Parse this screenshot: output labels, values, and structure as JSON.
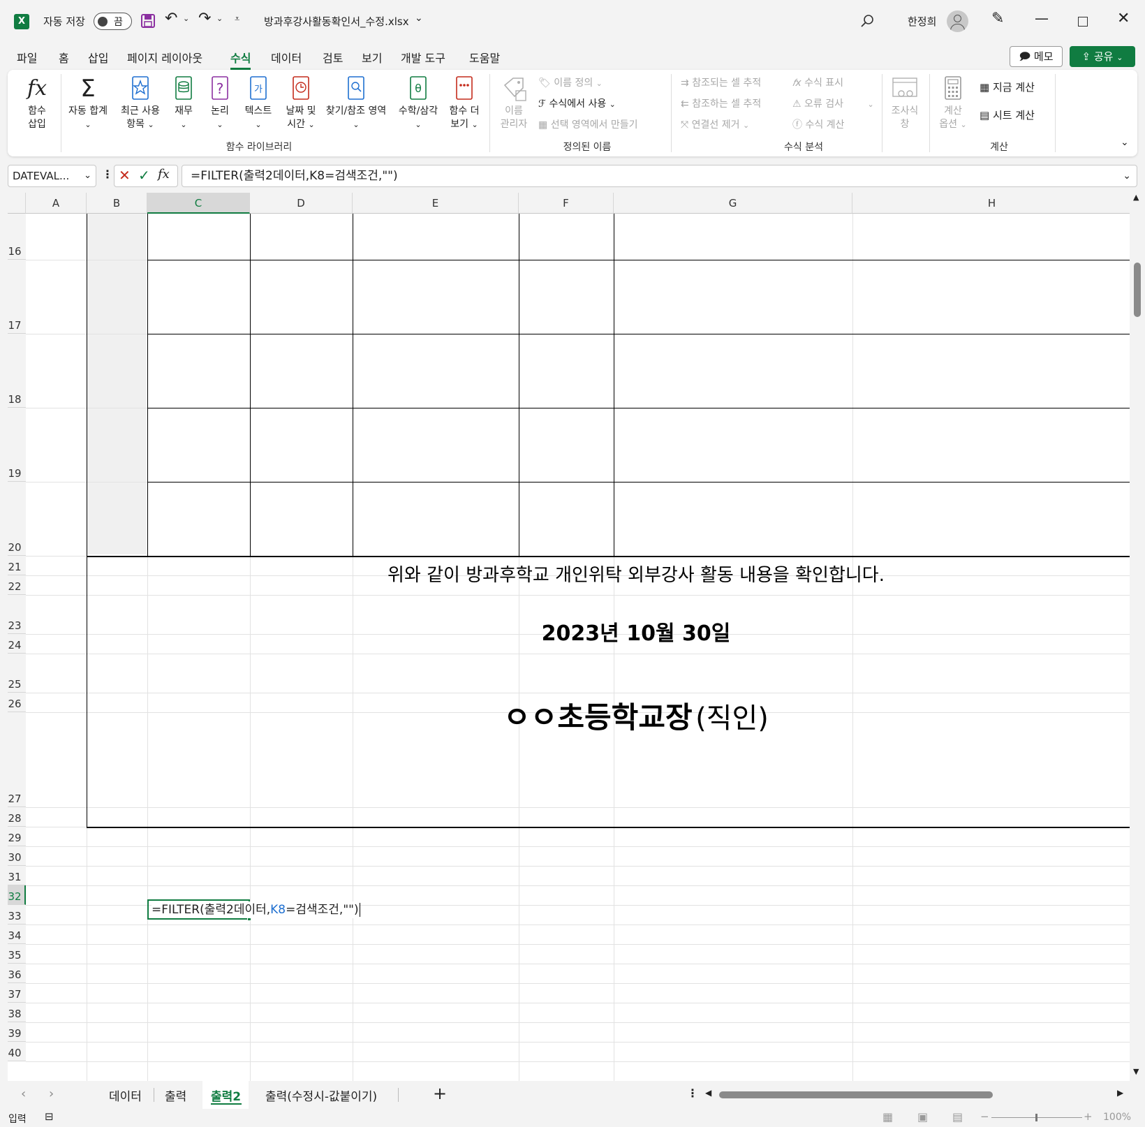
{
  "titlebar": {
    "autosave_label": "자동 저장",
    "autosave_state": "끔",
    "filename": "방과후강사활동확인서_수정.xlsx",
    "user_name": "한정희"
  },
  "menu": {
    "tabs": [
      "파일",
      "홈",
      "삽입",
      "페이지 레이아웃",
      "수식",
      "데이터",
      "검토",
      "보기",
      "개발 도구",
      "도움말"
    ],
    "active_tab": "수식",
    "memo_label": "메모",
    "share_label": "공유"
  },
  "ribbon": {
    "insert_function": [
      "함수",
      "삽입"
    ],
    "autosum": "자동 합계",
    "recent": [
      "최근 사용",
      "항목"
    ],
    "financial": "재무",
    "logical": "논리",
    "text": "텍스트",
    "datetime": [
      "날짜 및",
      "시간"
    ],
    "lookup": "찾기/참조 영역",
    "math": "수학/삼각",
    "more": [
      "함수 더",
      "보기"
    ],
    "group_library": "함수 라이브러리",
    "name_manager": [
      "이름",
      "관리자"
    ],
    "define_name": "이름 정의",
    "use_in_formula": "수식에서 사용",
    "create_from_selection": "선택 영역에서 만들기",
    "group_names": "정의된 이름",
    "trace_precedents": "참조되는 셀 추적",
    "trace_dependents": "참조하는 셀 추적",
    "remove_arrows": "연결선 제거",
    "show_formulas": "수식 표시",
    "error_checking": "오류 검사",
    "evaluate_formula": "수식 계산",
    "watch_window": [
      "조사식",
      "창"
    ],
    "group_audit": "수식 분석",
    "calc_options": [
      "계산",
      "옵션"
    ],
    "calc_now": "지금 계산",
    "calc_sheet": "시트 계산",
    "group_calc": "계산"
  },
  "formula_bar": {
    "name_box": "DATEVAL...",
    "formula": "=FILTER(출력2데이터,K8=검색조건,\"\")"
  },
  "columns": [
    "A",
    "B",
    "C",
    "D",
    "E",
    "F",
    "G",
    "H"
  ],
  "selected_column": "C",
  "rows": [
    "16",
    "17",
    "18",
    "19",
    "20",
    "21",
    "22",
    "23",
    "24",
    "25",
    "26",
    "27",
    "28",
    "29",
    "30",
    "31",
    "32",
    "33",
    "34",
    "35",
    "36",
    "37",
    "38",
    "39",
    "40"
  ],
  "selected_row": "32",
  "cells": {
    "confirm_text": "위와 같이 방과후학교 개인위탁 외부강사 활동 내용을 확인합니다.",
    "date_text": "2023년 10월 30일",
    "principal_text": "ㅇㅇ초등학교장",
    "seal_text": "(직인)",
    "edit_part1": "=FILTER(출력2데이터,",
    "edit_ref": "K8",
    "edit_part2": "=검색조건,\"\")"
  },
  "sheet_tabs": [
    "데이터",
    "출력",
    "출력2",
    "출력(수정시-값붙이기)"
  ],
  "active_sheet": "출력2",
  "status": {
    "mode": "입력",
    "zoom": "100%"
  }
}
